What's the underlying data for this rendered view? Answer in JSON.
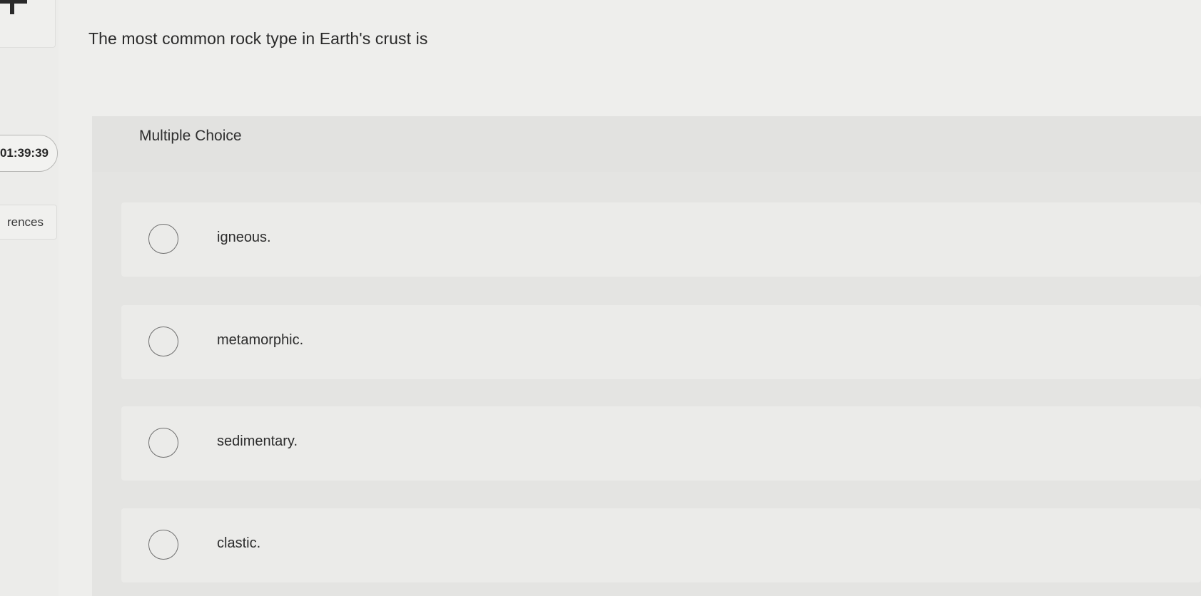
{
  "question": {
    "text": "The most common rock type in Earth's crust is"
  },
  "sidebar": {
    "timer_text": "01:39:39",
    "references_label": "rences"
  },
  "answer_panel": {
    "type_label": "Multiple Choice",
    "options": [
      {
        "label": "igneous."
      },
      {
        "label": "metamorphic."
      },
      {
        "label": "sedimentary."
      },
      {
        "label": "clastic."
      }
    ]
  },
  "icons": {
    "add": "plus-icon",
    "radio": "radio-unselected-icon"
  },
  "colors": {
    "page_background": "#eeeeec",
    "panel_background": "#e4e4e2",
    "option_background": "#ebebe9",
    "text": "#2b2b2b",
    "radio_border": "#6f6f6f"
  }
}
